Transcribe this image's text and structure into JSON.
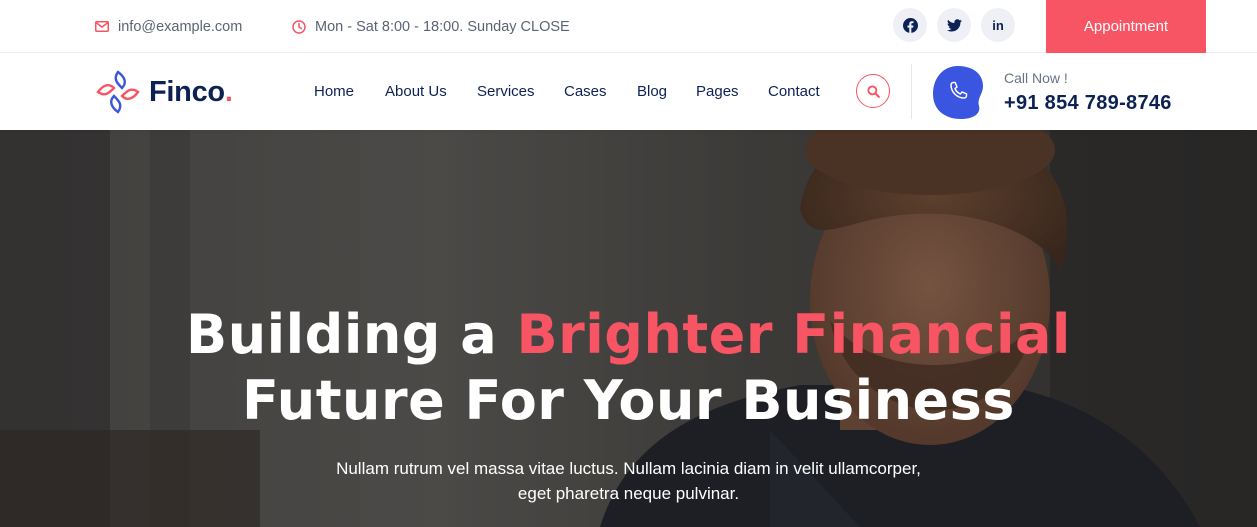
{
  "topbar": {
    "email": "info@example.com",
    "hours": "Mon - Sat 8:00 - 18:00. Sunday CLOSE",
    "social": [
      {
        "name": "facebook-icon"
      },
      {
        "name": "twitter-icon"
      },
      {
        "name": "linkedin-icon",
        "label": "in"
      }
    ],
    "appointment_label": "Appointment"
  },
  "header": {
    "logo_text": "Finco",
    "logo_dot": ".",
    "nav": [
      {
        "label": "Home"
      },
      {
        "label": "About Us"
      },
      {
        "label": "Services"
      },
      {
        "label": "Cases"
      },
      {
        "label": "Blog"
      },
      {
        "label": "Pages"
      },
      {
        "label": "Contact"
      }
    ],
    "call_label": "Call Now !",
    "call_number": "+91 854 789-8746"
  },
  "hero": {
    "title_part1": "Building a ",
    "title_highlight": "Brighter Financial",
    "title_line2": "Future For Your Business",
    "subtitle_line1": "Nullam rutrum vel massa vitae luctus. Nullam lacinia diam in velit ullamcorper,",
    "subtitle_line2": "eget pharetra neque pulvinar."
  },
  "colors": {
    "accent": "#f75464",
    "navy": "#0d2254",
    "phone_blue": "#3a55e0"
  }
}
